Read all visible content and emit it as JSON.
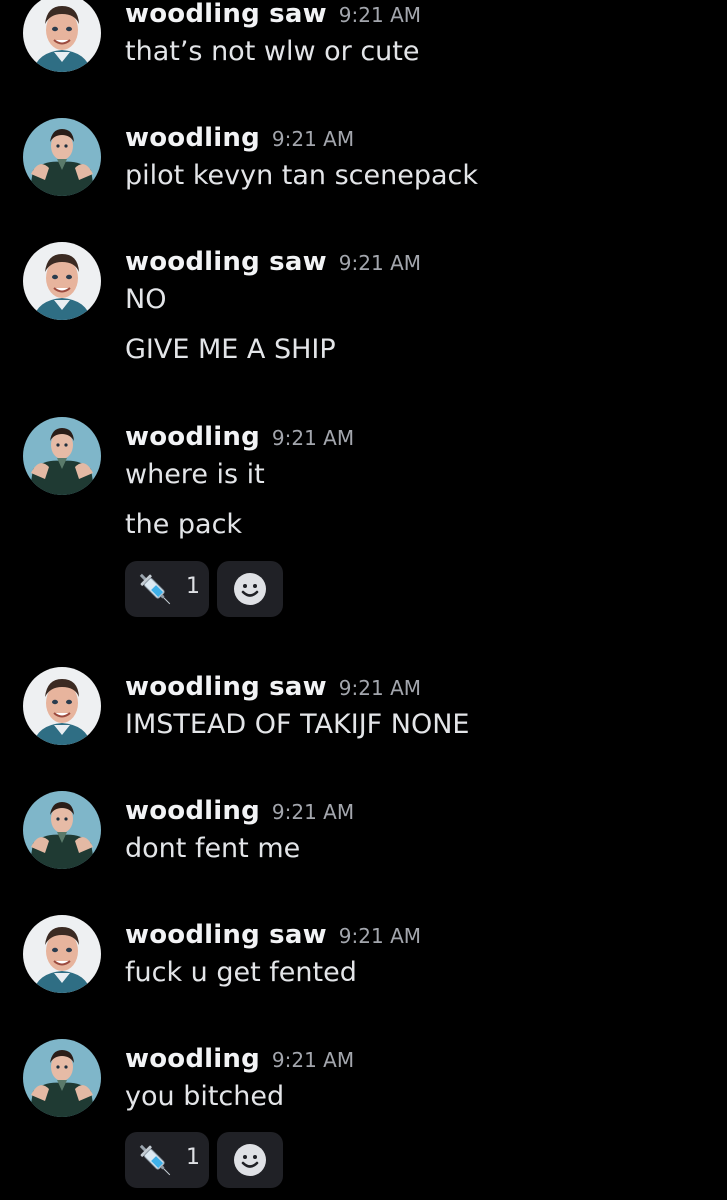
{
  "messages": [
    {
      "user": "woodling saw",
      "time": "9:21 AM",
      "avatar": "smiling-man-avatar",
      "lines": [
        "that’s not wlw or cute"
      ]
    },
    {
      "user": "woodling",
      "time": "9:21 AM",
      "avatar": "posing-man-avatar",
      "lines": [
        "pilot kevyn tan scenepack"
      ]
    },
    {
      "user": "woodling saw",
      "time": "9:21 AM",
      "avatar": "smiling-man-avatar",
      "lines": [
        "NO",
        "GIVE ME A SHIP"
      ]
    },
    {
      "user": "woodling",
      "time": "9:21 AM",
      "avatar": "posing-man-avatar",
      "lines": [
        "where is it",
        "the pack"
      ],
      "reaction": {
        "emoji": "syringe-icon",
        "count": "1"
      }
    },
    {
      "user": "woodling saw",
      "time": "9:21 AM",
      "avatar": "smiling-man-avatar",
      "lines": [
        "IMSTEAD OF TAKIJF NONE"
      ]
    },
    {
      "user": "woodling",
      "time": "9:21 AM",
      "avatar": "posing-man-avatar",
      "lines": [
        "dont fent me"
      ]
    },
    {
      "user": "woodling saw",
      "time": "9:21 AM",
      "avatar": "smiling-man-avatar",
      "lines": [
        "fuck u get fented"
      ]
    },
    {
      "user": "woodling",
      "time": "9:21 AM",
      "avatar": "posing-man-avatar",
      "lines": [
        "you bitched"
      ],
      "reaction": {
        "emoji": "syringe-icon",
        "count": "1"
      }
    }
  ],
  "colors": {
    "background": "#000000",
    "username": "#f2f3f5",
    "timestamp": "#a3a6ad",
    "message_text": "#e3e5e8",
    "reaction_pill": "#202126"
  }
}
